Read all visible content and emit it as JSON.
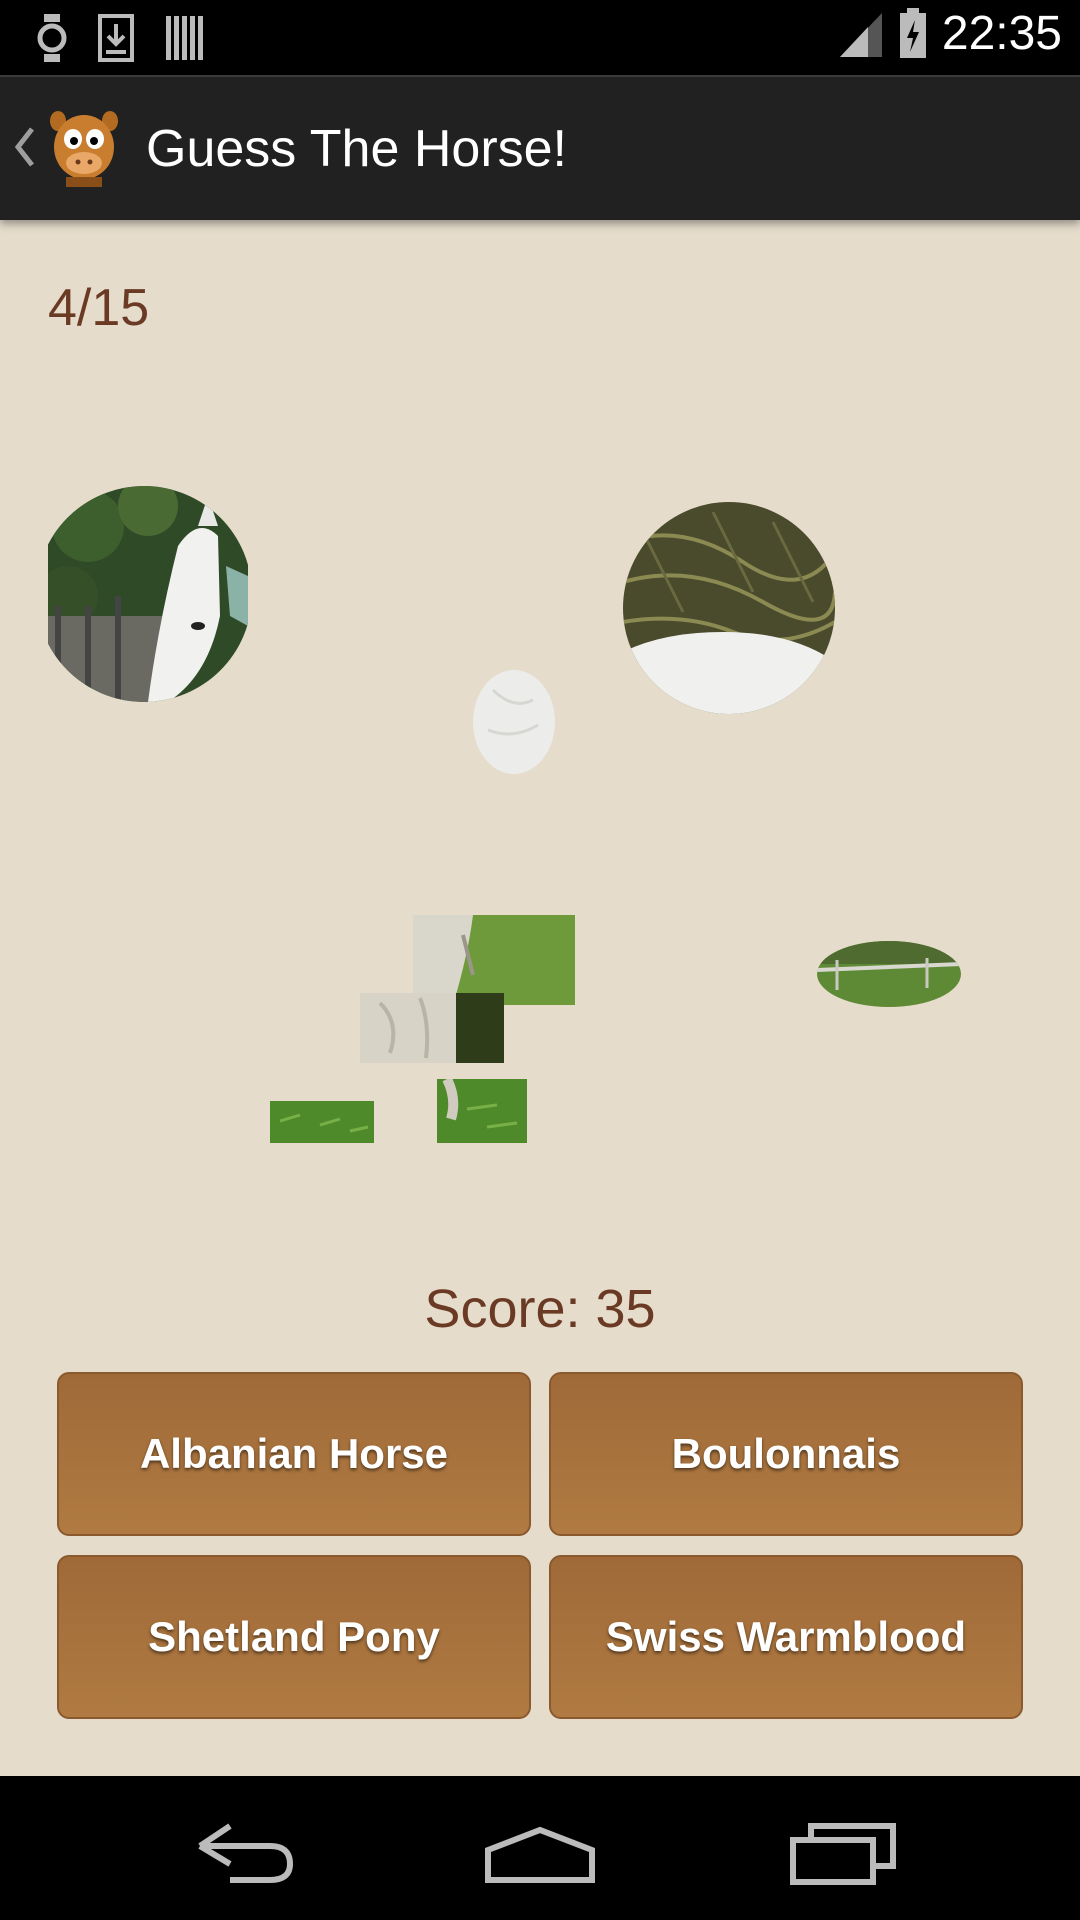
{
  "status_bar": {
    "time": "22:35",
    "icons": [
      "watch-icon",
      "download-icon",
      "barcode-icon",
      "signal-icon",
      "battery-charging-icon"
    ]
  },
  "app_bar": {
    "title": "Guess The Horse!",
    "back_icon": "chevron-left-icon",
    "logo_icon": "horse-face-logo-icon"
  },
  "game": {
    "progress": "4/15",
    "score": "Score: 35",
    "answers": [
      "Albanian Horse",
      "Boulonnais",
      "Shetland Pony",
      "Swiss Warmblood"
    ]
  },
  "nav_bar": {
    "icons": [
      "back-icon",
      "home-icon",
      "recents-icon"
    ]
  },
  "colors": {
    "background": "#e5dccb",
    "text_brown": "#6b3a24",
    "button_brown": "#a8733f",
    "app_bar": "#212121"
  }
}
